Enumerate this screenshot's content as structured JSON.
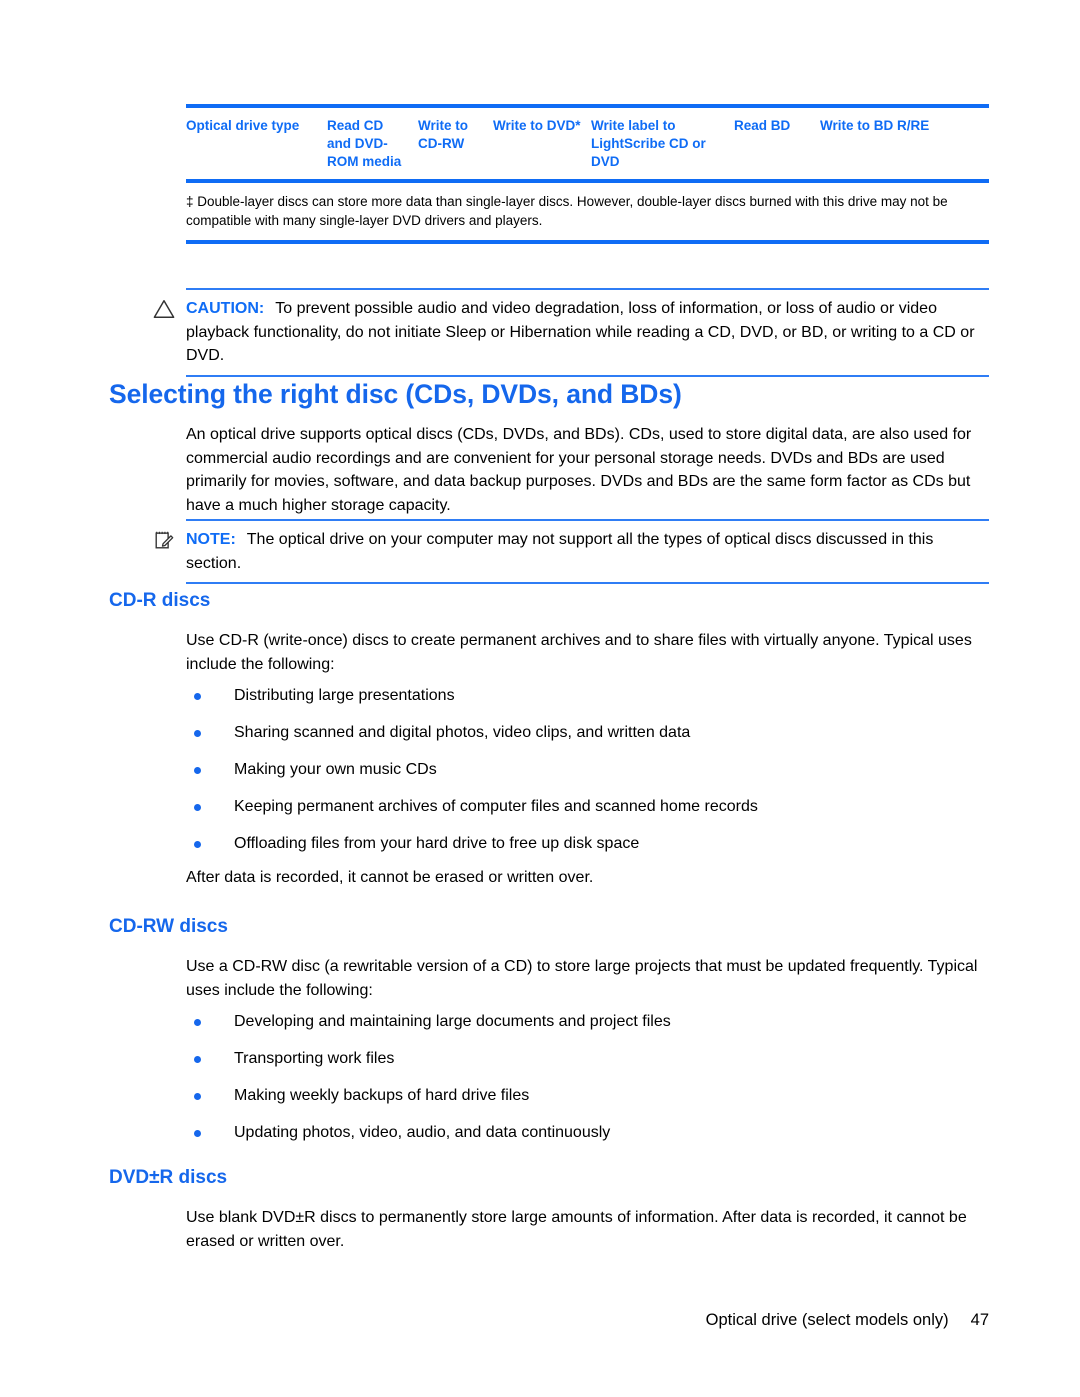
{
  "document": {
    "page_number": "47",
    "footer_title": "Optical drive (select models only)"
  },
  "table": {
    "headers": [
      "Optical drive type",
      "Read CD and DVD-ROM media",
      "Write to CD-RW",
      "Write to DVD*",
      "Write label to LightScribe CD or DVD",
      "Read BD",
      "Write to BD R/RE"
    ],
    "footnote": "‡ Double-layer discs can store more data than single-layer discs. However, double-layer discs burned with this drive may not be compatible with many single-layer DVD drivers and players."
  },
  "caution": {
    "icon": "warning-triangle-icon",
    "label": "CAUTION:",
    "text": "To prevent possible audio and video degradation, loss of information, or loss of audio or video playback functionality, do not initiate Sleep or Hibernation while reading a CD, DVD, or BD, or writing to a CD or DVD."
  },
  "note": {
    "icon": "note-pad-icon",
    "label": "NOTE:",
    "text": "The optical drive on your computer may not support all the types of optical discs discussed in this section."
  },
  "section": {
    "title": "Selecting the right disc (CDs, DVDs, and BDs)",
    "intro": "An optical drive supports optical discs (CDs, DVDs, and BDs). CDs, used to store digital data, are also used for commercial audio recordings and are convenient for your personal storage needs. DVDs and BDs are used primarily for movies, software, and data backup purposes. DVDs and BDs are the same form factor as CDs but have a much higher storage capacity."
  },
  "cdr": {
    "title": "CD-R discs",
    "intro": "Use CD-R (write-once) discs to create permanent archives and to share files with virtually anyone. Typical uses include the following:",
    "bullets": [
      "Distributing large presentations",
      "Sharing scanned and digital photos, video clips, and written data",
      "Making your own music CDs",
      "Keeping permanent archives of computer files and scanned home records",
      "Offloading files from your hard drive to free up disk space"
    ],
    "outro": "After data is recorded, it cannot be erased or written over."
  },
  "cdrw": {
    "title": "CD-RW discs",
    "intro": "Use a CD-RW disc (a rewritable version of a CD) to store large projects that must be updated frequently. Typical uses include the following:",
    "bullets": [
      "Developing and maintaining large documents and project files",
      "Transporting work files",
      "Making weekly backups of hard drive files",
      "Updating photos, video, audio, and data continuously"
    ]
  },
  "dvdr": {
    "title": "DVD±R discs",
    "intro": "Use blank DVD±R discs to permanently store large amounts of information. After data is recorded, it cannot be erased or written over."
  },
  "colors": {
    "accent_blue": "#0f6cf5",
    "heading_blue": "#1567ec",
    "text_black": "#000000"
  }
}
